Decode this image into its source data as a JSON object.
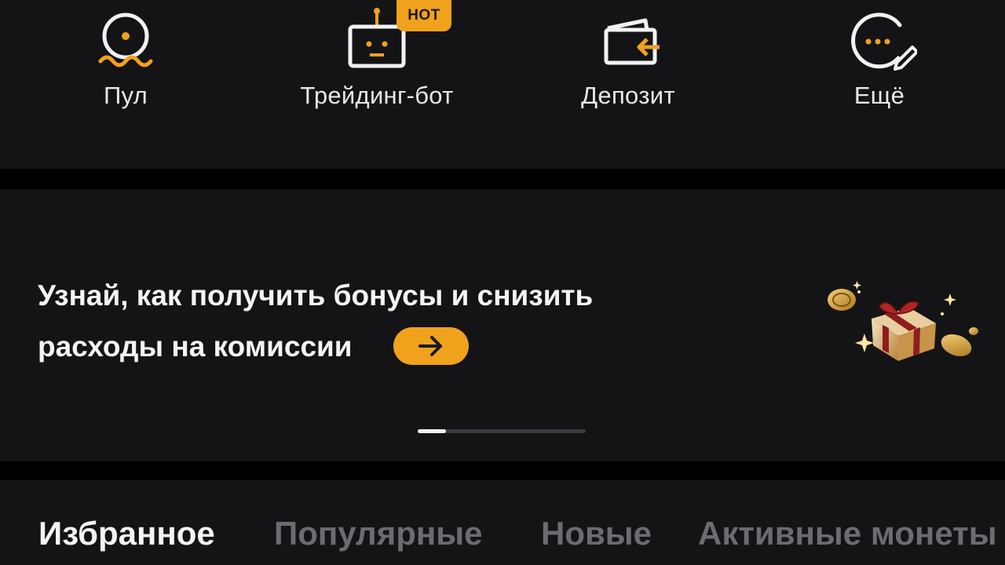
{
  "quick_actions": [
    {
      "label": "Пул",
      "icon": "pool-icon"
    },
    {
      "label": "Трейдинг-бот",
      "icon": "trading-bot-icon",
      "badge": "HOT"
    },
    {
      "label": "Депозит",
      "icon": "deposit-icon"
    },
    {
      "label": "Ещё",
      "icon": "more-icon"
    }
  ],
  "banner": {
    "line1": "Узнай, как получить бонусы и снизить",
    "line2": "расходы на комиссии",
    "pager": {
      "total_slides": 6,
      "active_index": 0
    }
  },
  "tabs": [
    {
      "label": "Избранное",
      "active": true
    },
    {
      "label": "Популярные",
      "active": false
    },
    {
      "label": "Новые",
      "active": false
    },
    {
      "label": "Активные монеты",
      "active": false
    }
  ],
  "colors": {
    "accent": "#f0a21c",
    "background": "#141417",
    "separator": "#000000",
    "inactive_tab": "#6b6b72"
  }
}
